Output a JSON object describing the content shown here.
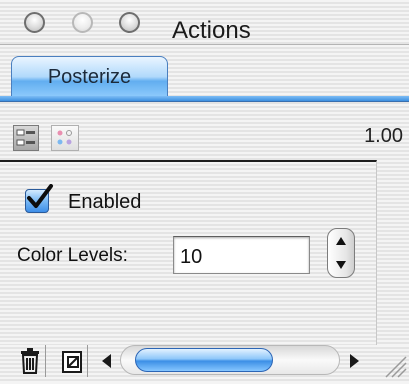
{
  "window": {
    "title": "Actions",
    "controls": [
      "close-button",
      "minimize-button",
      "zoom-button"
    ]
  },
  "tabs": [
    {
      "label": "Posterize",
      "selected": true
    }
  ],
  "toolbar": {
    "view_modes": [
      "list-view-icon",
      "icon-view-icon"
    ],
    "selected_view": "list-view-icon",
    "version": "1.00"
  },
  "action_panel": {
    "enabled_label": "Enabled",
    "enabled": true,
    "color_levels_label": "Color Levels:",
    "color_levels_value": "10"
  },
  "bottom_bar": {
    "icons": [
      "trash-icon",
      "new-action-icon",
      "scroll-left-arrow-icon",
      "scroll-right-arrow-icon",
      "resize-grip-icon"
    ]
  },
  "colors": {
    "accent": "#5aa8f0",
    "selected_tab": "#8ec7fa"
  }
}
